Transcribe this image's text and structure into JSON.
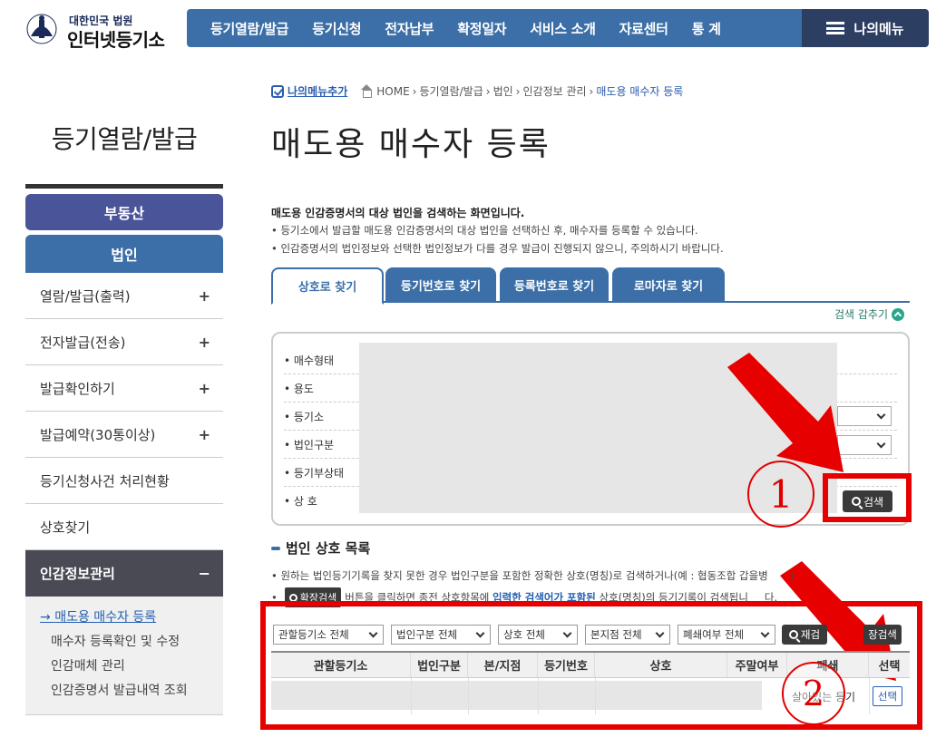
{
  "header": {
    "logo_small": "대한민국 법원",
    "logo_big": "인터넷등기소",
    "nav": [
      "등기열람/발급",
      "등기신청",
      "전자납부",
      "확정일자",
      "서비스 소개",
      "자료센터",
      "통 계"
    ],
    "mymenu_label": "나의메뉴"
  },
  "sidebar": {
    "title": "등기열람/발급",
    "realty_label": "부동산",
    "corp_label": "법인",
    "items": [
      {
        "label": "열람/발급(출력)",
        "mark": "+"
      },
      {
        "label": "전자발급(전송)",
        "mark": "+"
      },
      {
        "label": "발급확인하기",
        "mark": "+"
      },
      {
        "label": "발급예약(30통이상)",
        "mark": "+"
      },
      {
        "label": "등기신청사건 처리현황",
        "mark": ""
      },
      {
        "label": "상호찾기",
        "mark": ""
      },
      {
        "label": "인감정보관리",
        "mark": "−"
      }
    ],
    "sub_items": [
      "매도용 매수자 등록",
      "매수자 등록확인 및 수정",
      "인감매체 관리",
      "인감증명서 발급내역 조회"
    ]
  },
  "breadcrumb": {
    "add_menu": "나의메뉴추가",
    "path": [
      "HOME",
      "등기열람/발급",
      "법인",
      "인감정보 관리"
    ],
    "current": "매도용 매수자 등록"
  },
  "page": {
    "title": "매도용 매수자 등록",
    "intro_bold": "매도용 인감증명서의 대상 법인을 검색하는 화면입니다.",
    "intro_lines": [
      "• 등기소에서 발급할 매도용 인감증명서의 대상 법인을 선택하신 후, 매수자를 등록할 수 있습니다.",
      "• 인감증명서의 법인정보와 선택한 법인정보가 다를 경우 발급이 진행되지 않으니, 주의하시기 바랍니다."
    ]
  },
  "tabs": [
    "상호로 찾기",
    "등기번호로 찾기",
    "등록번호로 찾기",
    "로마자로 찾기"
  ],
  "collapse_label": "검색 감추기",
  "search_form": {
    "fields": [
      "• 매수형태",
      "• 용도",
      "• 등기소",
      "• 법인구분",
      "• 등기부상태",
      "• 상 호"
    ],
    "search_button": "검색"
  },
  "annotations": {
    "step1": "1",
    "step2": "2"
  },
  "list": {
    "title": "법인 상호 목록",
    "note1": "• 원하는 법인등기기록을 찾지 못한 경우 법인구분을 포함한 정확한 상호(명칭)로 검색하거나(예 : 협동조합 갑을병",
    "note1_tail": ")",
    "note2_pre": "•",
    "ext_button": "확장검색",
    "note2_a": "버튼을 클릭하면 종전 상호항목에",
    "note2_hl": "입력한 검색어가 포함된",
    "note2_b": "상호(명칭)의 등기기록이 검색됩니",
    "note2_tail": "다.",
    "filters": [
      "관할등기소 전체",
      "법인구분 전체",
      "상호 전체",
      "본지점 전체",
      "폐쇄여부 전체"
    ],
    "refine_button": "재검",
    "ext_search_button": "장검색",
    "columns": [
      "관할등기소",
      "법인구분",
      "본/지점",
      "등기번호",
      "상호",
      "주말여부",
      "폐쇄",
      "선택"
    ],
    "row_status": "살아있는 등기",
    "select_button": "선택"
  },
  "colors": {
    "primary": "#3c6fa7",
    "dark_nav": "#2c3f63",
    "highlight_red": "#e60000",
    "side_active": "#4a4a55"
  }
}
